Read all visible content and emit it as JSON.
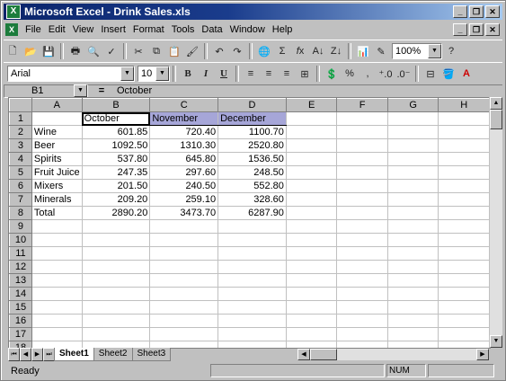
{
  "window": {
    "title": "Microsoft Excel - Drink Sales.xls"
  },
  "menu": [
    "File",
    "Edit",
    "View",
    "Insert",
    "Format",
    "Tools",
    "Data",
    "Window",
    "Help"
  ],
  "toolbar": {
    "zoom": "100%",
    "font_name": "Arial",
    "font_size": "10",
    "comma_style": ",",
    "percent_style": "%"
  },
  "formula_bar": {
    "cell_ref": "B1",
    "eq_sign": "=",
    "content": "October"
  },
  "columns": [
    "A",
    "B",
    "C",
    "D",
    "E",
    "F",
    "G",
    "H"
  ],
  "rows": [
    [
      "",
      "October",
      "November",
      "December",
      "",
      "",
      "",
      ""
    ],
    [
      "Wine",
      "601.85",
      "720.40",
      "1100.70",
      "",
      "",
      "",
      ""
    ],
    [
      "Beer",
      "1092.50",
      "1310.30",
      "2520.80",
      "",
      "",
      "",
      ""
    ],
    [
      "Spirits",
      "537.80",
      "645.80",
      "1536.50",
      "",
      "",
      "",
      ""
    ],
    [
      "Fruit Juice",
      "247.35",
      "297.60",
      "248.50",
      "",
      "",
      "",
      ""
    ],
    [
      "Mixers",
      "201.50",
      "240.50",
      "552.80",
      "",
      "",
      "",
      ""
    ],
    [
      "Minerals",
      "209.20",
      "259.10",
      "328.60",
      "",
      "",
      "",
      ""
    ],
    [
      "Total",
      "2890.20",
      "3473.70",
      "6287.90",
      "",
      "",
      "",
      ""
    ],
    [
      "",
      "",
      "",
      "",
      "",
      "",
      "",
      ""
    ],
    [
      "",
      "",
      "",
      "",
      "",
      "",
      "",
      ""
    ],
    [
      "",
      "",
      "",
      "",
      "",
      "",
      "",
      ""
    ],
    [
      "",
      "",
      "",
      "",
      "",
      "",
      "",
      ""
    ],
    [
      "",
      "",
      "",
      "",
      "",
      "",
      "",
      ""
    ],
    [
      "",
      "",
      "",
      "",
      "",
      "",
      "",
      ""
    ],
    [
      "",
      "",
      "",
      "",
      "",
      "",
      "",
      ""
    ],
    [
      "",
      "",
      "",
      "",
      "",
      "",
      "",
      ""
    ],
    [
      "",
      "",
      "",
      "",
      "",
      "",
      "",
      ""
    ],
    [
      "",
      "",
      "",
      "",
      "",
      "",
      "",
      ""
    ]
  ],
  "sheets": [
    "Sheet1",
    "Sheet2",
    "Sheet3"
  ],
  "status": {
    "text": "Ready",
    "num": "NUM"
  },
  "colors": {
    "title_bar": "#0a246a",
    "header_fill": "#a6a6d8"
  }
}
